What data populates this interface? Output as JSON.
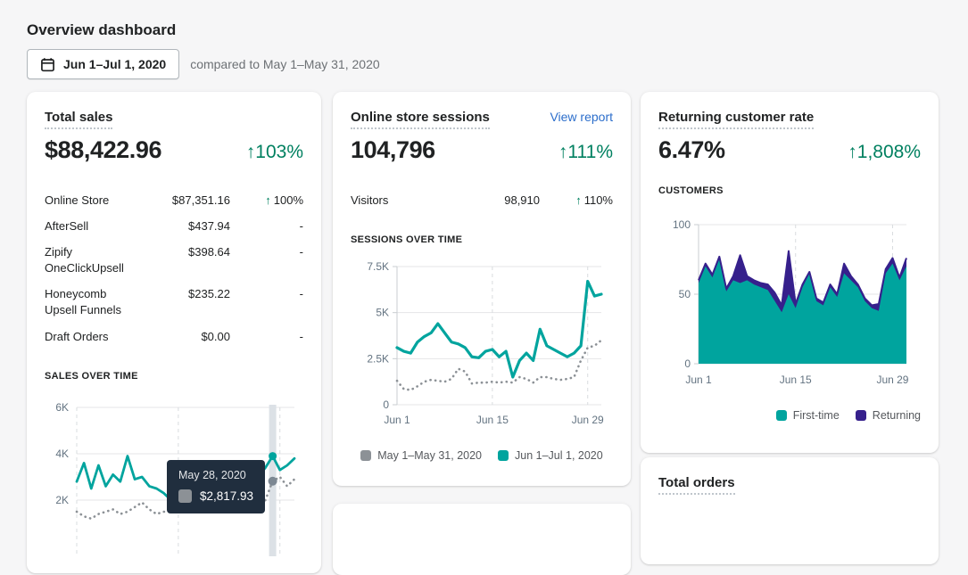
{
  "page": {
    "title": "Overview dashboard"
  },
  "toolbar": {
    "date_range": "Jun 1–Jul 1, 2020",
    "compare_text": "compared to May 1–May 31, 2020"
  },
  "colors": {
    "accent_teal": "#00a49e",
    "accent_purple": "#36208c",
    "comparison_gray": "#8c9196",
    "positive_green": "#008060",
    "link_blue": "#2c6ecb"
  },
  "cards": {
    "total_sales": {
      "title": "Total sales",
      "value": "$88,422.96",
      "change": "↑103%",
      "rows": [
        {
          "label": "Online Store",
          "value": "$87,351.16",
          "arrow": "↑",
          "change": "100%"
        },
        {
          "label": "AfterSell",
          "value": "$437.94",
          "arrow": "",
          "change": "-"
        },
        {
          "label": "Zipify OneClickUpsell",
          "value": "$398.64",
          "arrow": "",
          "change": "-"
        },
        {
          "label": "Honeycomb Upsell Funnels",
          "value": "$235.22",
          "arrow": "",
          "change": "-"
        },
        {
          "label": "Draft Orders",
          "value": "$0.00",
          "arrow": "",
          "change": "-"
        }
      ]
    },
    "online_store_sessions": {
      "title": "Online store sessions",
      "link": "View report",
      "value": "104,796",
      "change": "↑111%",
      "rows": [
        {
          "label": "Visitors",
          "value": "98,910",
          "arrow": "↑",
          "change": "110%"
        }
      ]
    },
    "returning_customer_rate": {
      "title": "Returning customer rate",
      "value": "6.47%",
      "change": "↑1,808%"
    },
    "total_orders": {
      "title": "Total orders"
    }
  },
  "chart_data": [
    {
      "id": "sales-over-time",
      "type": "line",
      "title": "SALES OVER TIME",
      "ylim": [
        0,
        6000
      ],
      "y_ticks": [
        {
          "v": 6000,
          "label": "6K"
        },
        {
          "v": 4000,
          "label": "4K"
        },
        {
          "v": 2000,
          "label": "2K"
        }
      ],
      "x_grid_fractions": [
        0,
        0.4667,
        0.9333
      ],
      "series": [
        {
          "name": "Jun 1–Jul 1, 2020",
          "style": "solid",
          "color": "#00a49e",
          "values": [
            2800,
            3600,
            2500,
            3500,
            2600,
            3100,
            2800,
            3900,
            2900,
            3000,
            2600,
            2500,
            2300,
            2000,
            2400,
            2200,
            2600,
            2400,
            2700,
            2500,
            2800,
            2600,
            2900,
            3100,
            2800,
            3000,
            3400,
            3900,
            3300,
            3500,
            3800
          ]
        },
        {
          "name": "May 1–May 31, 2020",
          "style": "dotted",
          "color": "#8c9196",
          "values": [
            1500,
            1300,
            1200,
            1400,
            1500,
            1600,
            1400,
            1500,
            1700,
            1900,
            1600,
            1400,
            1500,
            1500,
            1600,
            1500,
            1600,
            1500,
            1700,
            1600,
            1500,
            1700,
            1800,
            1700,
            1600,
            1800,
            2000,
            2817.93,
            3000,
            2600,
            2900
          ]
        }
      ],
      "highlight": {
        "index": 27,
        "date": "May 28, 2020",
        "value": "$2,817.93",
        "swatch_color": "#8c9196"
      }
    },
    {
      "id": "sessions-over-time",
      "type": "line",
      "title": "SESSIONS OVER TIME",
      "ylim": [
        0,
        7500
      ],
      "y_ticks": [
        {
          "v": 7500,
          "label": "7.5K"
        },
        {
          "v": 5000,
          "label": "5K"
        },
        {
          "v": 2500,
          "label": "2.5K"
        },
        {
          "v": 0,
          "label": "0"
        }
      ],
      "x_ticks": [
        {
          "index": 0,
          "label": "Jun 1"
        },
        {
          "index": 14,
          "label": "Jun 15"
        },
        {
          "index": 28,
          "label": "Jun 29"
        }
      ],
      "series": [
        {
          "name": "Jun 1–Jul 1, 2020",
          "style": "solid",
          "color": "#00a49e",
          "values": [
            3100,
            2900,
            2800,
            3400,
            3700,
            3900,
            4400,
            3900,
            3400,
            3300,
            3100,
            2600,
            2550,
            2900,
            3000,
            2600,
            2900,
            1500,
            2400,
            2800,
            2400,
            4100,
            3200,
            3000,
            2800,
            2600,
            2800,
            3200,
            6700,
            5900,
            6000
          ]
        },
        {
          "name": "May 1–May 31, 2020",
          "style": "dotted",
          "color": "#8c9196",
          "values": [
            1300,
            850,
            800,
            1000,
            1250,
            1350,
            1300,
            1250,
            1400,
            1950,
            1800,
            1150,
            1200,
            1200,
            1250,
            1200,
            1250,
            1200,
            1500,
            1400,
            1200,
            1500,
            1500,
            1400,
            1350,
            1400,
            1500,
            2400,
            3100,
            3200,
            3500
          ]
        }
      ],
      "legend": [
        {
          "label": "May 1–May 31, 2020",
          "color": "#8c9196"
        },
        {
          "label": "Jun 1–Jul 1, 2020",
          "color": "#00a49e"
        }
      ]
    },
    {
      "id": "customers",
      "type": "area",
      "stacked": true,
      "title": "CUSTOMERS",
      "ylim": [
        0,
        100
      ],
      "y_ticks": [
        {
          "v": 100,
          "label": "100"
        },
        {
          "v": 50,
          "label": "50"
        },
        {
          "v": 0,
          "label": "0"
        }
      ],
      "x_ticks": [
        {
          "index": 0,
          "label": "Jun 1"
        },
        {
          "index": 14,
          "label": "Jun 15"
        },
        {
          "index": 28,
          "label": "Jun 29"
        }
      ],
      "series": [
        {
          "name": "First-time",
          "color": "#00a49e",
          "values": [
            58,
            70,
            62,
            76,
            52,
            60,
            58,
            60,
            57,
            55,
            53,
            45,
            37,
            50,
            40,
            55,
            65,
            45,
            42,
            55,
            48,
            65,
            60,
            55,
            45,
            40,
            38,
            65,
            72,
            60,
            70
          ]
        },
        {
          "name": "Returning",
          "color": "#36208c",
          "values": [
            2,
            2,
            2,
            1,
            2,
            3,
            20,
            3,
            3,
            3,
            4,
            6,
            5,
            31,
            3,
            2,
            1,
            2,
            2,
            2,
            2,
            7,
            3,
            2,
            2,
            2,
            5,
            3,
            4,
            2,
            6
          ]
        }
      ],
      "legend": [
        {
          "label": "First-time",
          "color": "#00a49e"
        },
        {
          "label": "Returning",
          "color": "#36208c"
        }
      ]
    }
  ]
}
